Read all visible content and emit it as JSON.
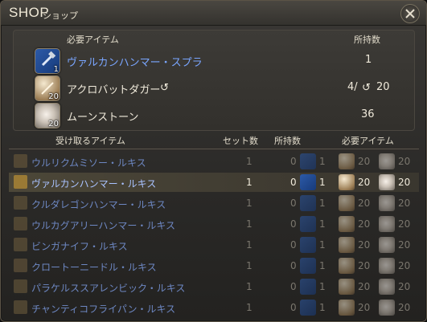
{
  "window": {
    "title": "SHOP",
    "subtitle": "ショップ",
    "close_icon": "crossed-tools-icon"
  },
  "required_panel": {
    "header_item": "必要アイテム",
    "header_owned": "所持数",
    "items": [
      {
        "name": "ヴァルカンハンマー・スプラ",
        "icon": "hammer-icon",
        "icon_qty": "1",
        "owned": "1",
        "highlight": true
      },
      {
        "name": "アクロバットダガー",
        "icon": "dagger-icon",
        "icon_qty": "20",
        "owned": "4/",
        "owned_total": "20",
        "has_collect_icon": true
      },
      {
        "name": "ムーンストーン",
        "icon": "moonstone-icon",
        "icon_qty": "20",
        "owned": "36"
      }
    ]
  },
  "list_headers": {
    "receive": "受け取るアイテム",
    "sets": "セット数",
    "owned": "所持数",
    "required": "必要アイテム"
  },
  "rows": [
    {
      "name": "ウルリクムミソー・ルキス",
      "sets": "1",
      "owned": "0",
      "own_qty": "1",
      "req1": "20",
      "req2": "20",
      "icon": "saw-icon",
      "selected": false
    },
    {
      "name": "ヴァルカンハンマー・ルキス",
      "sets": "1",
      "owned": "0",
      "own_qty": "1",
      "req1": "20",
      "req2": "20",
      "icon": "anvil-hammer-icon",
      "selected": true
    },
    {
      "name": "クルダレゴンハンマー・ルキス",
      "sets": "1",
      "owned": "0",
      "own_qty": "1",
      "req1": "20",
      "req2": "20",
      "icon": "hammer-icon",
      "selected": false
    },
    {
      "name": "ウルカグアリーハンマー・ルキス",
      "sets": "1",
      "owned": "0",
      "own_qty": "1",
      "req1": "20",
      "req2": "20",
      "icon": "crown-hammer-icon",
      "selected": false
    },
    {
      "name": "ビンガナイフ・ルキス",
      "sets": "1",
      "owned": "0",
      "own_qty": "1",
      "req1": "20",
      "req2": "20",
      "icon": "knife-icon",
      "selected": false
    },
    {
      "name": "クロートーニードル・ルキス",
      "sets": "1",
      "owned": "0",
      "own_qty": "1",
      "req1": "20",
      "req2": "20",
      "icon": "needle-icon",
      "selected": false
    },
    {
      "name": "パラケルススアレンビック・ルキス",
      "sets": "1",
      "owned": "0",
      "own_qty": "1",
      "req1": "20",
      "req2": "20",
      "icon": "alembic-icon",
      "selected": false
    },
    {
      "name": "チャンティコフライパン・ルキス",
      "sets": "1",
      "owned": "0",
      "own_qty": "1",
      "req1": "20",
      "req2": "20",
      "icon": "frypan-icon",
      "selected": false
    }
  ],
  "colors": {
    "highlight_text": "#7aa6ff",
    "row_name": "#6d87c2",
    "selected_bg": "#4c4738"
  }
}
